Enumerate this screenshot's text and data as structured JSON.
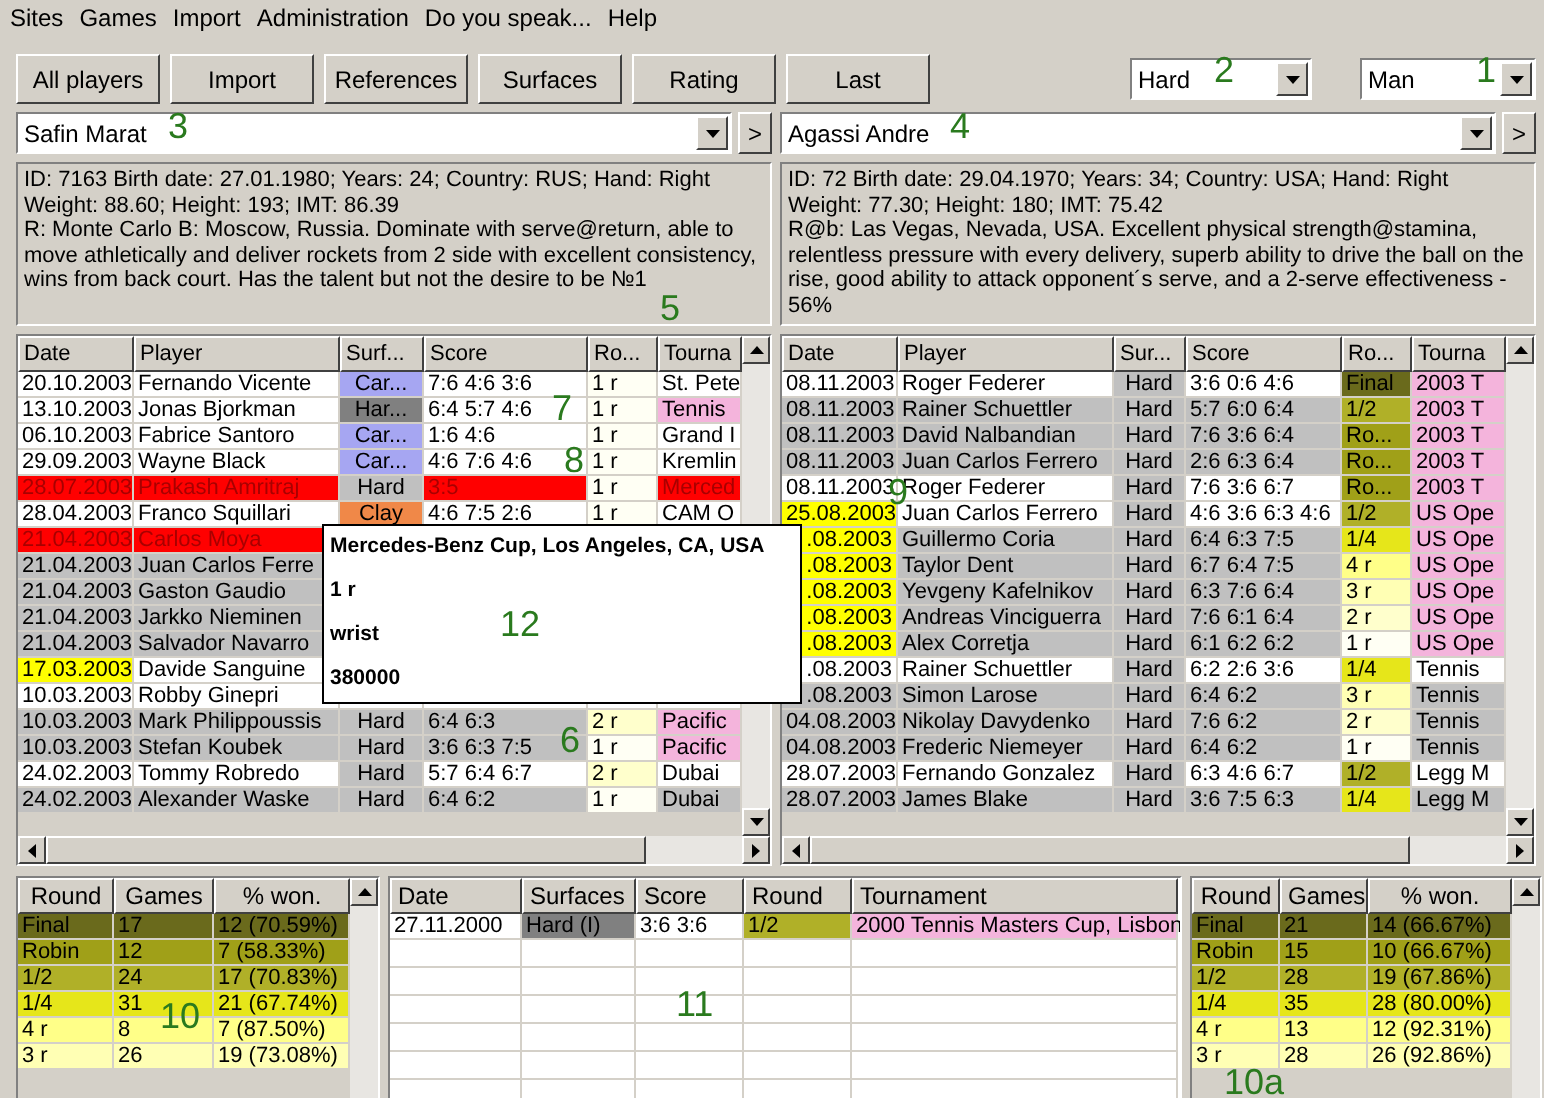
{
  "menu": [
    "Sites",
    "Games",
    "Import",
    "Administration",
    "Do you speak...",
    "Help"
  ],
  "toolbar": [
    "All players",
    "Import",
    "References",
    "Surfaces",
    "Rating",
    "Last"
  ],
  "surface_filter": {
    "value": "Hard"
  },
  "gender_filter": {
    "value": "Man"
  },
  "players": [
    {
      "name": "Safin Marat",
      "next_button": ">",
      "info": [
        "ID: 7163 Birth date: 27.01.1980; Years: 24; Country: RUS; Hand: Right",
        "Weight: 88.60; Height: 193; IMT: 86.39",
        "R: Monte Carlo B: Moscow, Russia. Dominate with serve@return, able to move athletically and deliver rockets from 2 side with excellent consistency, wins from back court. Has the talent but not the desire to be №1"
      ]
    },
    {
      "name": "Agassi Andre",
      "next_button": ">",
      "info": [
        "ID: 72 Birth date: 29.04.1970; Years: 34; Country: USA; Hand: Right",
        "Weight: 77.30; Height: 180; IMT: 75.42",
        "R@b: Las Vegas, Nevada, USA. Excellent physical strength@stamina, relentless pressure with every delivery, superb ability to drive the ball on the rise, good ability to attack opponent´s serve, and a 2-serve effectiveness - 56%"
      ]
    }
  ],
  "left_table": {
    "columns": [
      "Date",
      "Player",
      "Surf...",
      "Score",
      "Ro...",
      "Tourna"
    ],
    "rows": [
      {
        "date": "20.10.2003",
        "date_highlight": false,
        "player": "Fernando Vicente",
        "color": "#ffffff",
        "lost": false,
        "surface": {
          "text": "Car...",
          "color": "#a6a6f2"
        },
        "score": "7:6 4:6 3:6",
        "round": {
          "text": "1 r",
          "color": "#fffff4"
        },
        "tournament": {
          "text": "St. Pete"
        }
      },
      {
        "date": "13.10.2003",
        "date_highlight": false,
        "player": "Jonas Bjorkman",
        "color": "#ffffff",
        "lost": false,
        "surface": {
          "text": "Har...",
          "color": "#808080"
        },
        "score": "6:4 5:7 4:6",
        "round": {
          "text": "1 r",
          "color": "#fffff4"
        },
        "tournament": {
          "text": "Tennis",
          "color": "#f4b4dc"
        }
      },
      {
        "date": "06.10.2003",
        "date_highlight": false,
        "player": "Fabrice Santoro",
        "color": "#ffffff",
        "lost": false,
        "surface": {
          "text": "Car...",
          "color": "#a6a6f2"
        },
        "score": "1:6 4:6",
        "round": {
          "text": "1 r",
          "color": "#fffff4"
        },
        "tournament": {
          "text": "Grand I"
        }
      },
      {
        "date": "29.09.2003",
        "date_highlight": false,
        "player": "Wayne Black",
        "color": "#ffffff",
        "lost": false,
        "surface": {
          "text": "Car...",
          "color": "#a6a6f2"
        },
        "score": "4:6 7:6 4:6",
        "round": {
          "text": "1 r",
          "color": "#fffff4"
        },
        "tournament": {
          "text": "Kremlin"
        }
      },
      {
        "date": "28.07.2003",
        "date_highlight": false,
        "player": "Prakash Amritraj",
        "color": "#ff0000",
        "lost": true,
        "surface": {
          "text": "Hard",
          "color": "#c0c0c0"
        },
        "score": "3:5",
        "round": {
          "text": "1 r",
          "color": "#fffff4"
        },
        "tournament": {
          "text": "Merced"
        }
      },
      {
        "date": "28.04.2003",
        "date_highlight": false,
        "player": "Franco Squillari",
        "color": "#ffffff",
        "lost": false,
        "surface": {
          "text": "Clay",
          "color": "#f08848"
        },
        "score": "4:6 7:5 2:6",
        "round": {
          "text": "1 r",
          "color": "#fffff4"
        },
        "tournament": {
          "text": "CAM O"
        }
      },
      {
        "date": "21.04.2003",
        "date_highlight": false,
        "player": "Carlos Moya",
        "color": "#ff0000",
        "lost": true
      },
      {
        "date": "21.04.2003",
        "date_highlight": false,
        "player": "Juan Carlos Ferre",
        "color": "#c0c0c0",
        "lost": false
      },
      {
        "date": "21.04.2003",
        "date_highlight": false,
        "player": "Gaston Gaudio",
        "color": "#c0c0c0",
        "lost": false
      },
      {
        "date": "21.04.2003",
        "date_highlight": false,
        "player": "Jarkko Nieminen",
        "color": "#c0c0c0",
        "lost": false
      },
      {
        "date": "21.04.2003",
        "date_highlight": false,
        "player": "Salvador Navarro",
        "color": "#c0c0c0",
        "lost": false
      },
      {
        "date": "17.03.2003",
        "date_highlight": true,
        "player": "Davide Sanguine",
        "color": "#ffffff",
        "lost": false
      },
      {
        "date": "10.03.2003",
        "date_highlight": false,
        "player": "Robby Ginepri",
        "color": "#ffffff",
        "lost": false
      },
      {
        "date": "10.03.2003",
        "date_highlight": false,
        "player": "Mark Philippoussis",
        "color": "#c0c0c0",
        "lost": false,
        "surface": {
          "text": "Hard",
          "color": "#c0c0c0"
        },
        "score": "6:4 6:3",
        "round": {
          "text": "2 r",
          "color": "#ffffcc"
        },
        "tournament": {
          "text": "Pacific",
          "color": "#f4b4dc"
        }
      },
      {
        "date": "10.03.2003",
        "date_highlight": false,
        "player": "Stefan Koubek",
        "color": "#c0c0c0",
        "lost": false,
        "surface": {
          "text": "Hard",
          "color": "#c0c0c0"
        },
        "score": "3:6 6:3 7:5",
        "round": {
          "text": "1 r",
          "color": "#fffff4"
        },
        "tournament": {
          "text": "Pacific",
          "color": "#f4b4dc"
        }
      },
      {
        "date": "24.02.2003",
        "date_highlight": false,
        "player": "Tommy Robredo",
        "color": "#ffffff",
        "lost": false,
        "surface": {
          "text": "Hard",
          "color": "#c0c0c0"
        },
        "score": "5:7 6:4 6:7",
        "round": {
          "text": "2 r",
          "color": "#ffffcc"
        },
        "tournament": {
          "text": "Dubai"
        }
      },
      {
        "date": "24.02.2003",
        "date_highlight": false,
        "player": "Alexander Waske",
        "color": "#c0c0c0",
        "lost": false,
        "surface": {
          "text": "Hard",
          "color": "#c0c0c0"
        },
        "score": "6:4 6:2",
        "round": {
          "text": "1 r",
          "color": "#fffff4"
        },
        "tournament": {
          "text": "Dubai"
        }
      }
    ]
  },
  "right_table": {
    "columns": [
      "Date",
      "Player",
      "Sur...",
      "Score",
      "Ro...",
      "Tourna"
    ],
    "rows": [
      {
        "date": "08.11.2003",
        "date_highlight": false,
        "player": "Roger Federer",
        "color": "#ffffff",
        "lost": false,
        "surface": {
          "text": "Hard",
          "color": "#c0c0c0"
        },
        "score": "3:6 0:6 4:6",
        "round": {
          "text": "Final",
          "color": "#6a6a1c"
        },
        "tournament": {
          "text": "2003 T",
          "color": "#f4b4dc"
        }
      },
      {
        "date": "08.11.2003",
        "date_highlight": false,
        "player": "Rainer Schuettler",
        "color": "#c0c0c0",
        "lost": false,
        "surface": {
          "text": "Hard",
          "color": "#c0c0c0"
        },
        "score": "5:7 6:0 6:4",
        "round": {
          "text": "1/2",
          "color": "#b0b028"
        },
        "tournament": {
          "text": "2003 T",
          "color": "#f4b4dc"
        }
      },
      {
        "date": "08.11.2003",
        "date_highlight": false,
        "player": "David Nalbandian",
        "color": "#c0c0c0",
        "lost": false,
        "surface": {
          "text": "Hard",
          "color": "#c0c0c0"
        },
        "score": "7:6 3:6 6:4",
        "round": {
          "text": "Ro...",
          "color": "#a0a018"
        },
        "tournament": {
          "text": "2003 T",
          "color": "#f4b4dc"
        }
      },
      {
        "date": "08.11.2003",
        "date_highlight": false,
        "player": "Juan Carlos Ferrero",
        "color": "#c0c0c0",
        "lost": false,
        "surface": {
          "text": "Hard",
          "color": "#c0c0c0"
        },
        "score": "2:6 6:3 6:4",
        "round": {
          "text": "Ro...",
          "color": "#a0a018"
        },
        "tournament": {
          "text": "2003 T",
          "color": "#f4b4dc"
        }
      },
      {
        "date": "08.11.2003",
        "date_highlight": false,
        "player": "Roger Federer",
        "color": "#ffffff",
        "lost": false,
        "surface": {
          "text": "Hard",
          "color": "#c0c0c0"
        },
        "score": "7:6 3:6 6:7",
        "round": {
          "text": "Ro...",
          "color": "#a0a018"
        },
        "tournament": {
          "text": "2003 T",
          "color": "#f4b4dc"
        }
      },
      {
        "date": "25.08.2003",
        "date_highlight": true,
        "player": "Juan Carlos Ferrero",
        "color": "#ffffff",
        "lost": false,
        "surface": {
          "text": "Hard",
          "color": "#c0c0c0"
        },
        "score": "4:6 3:6 6:3 4:6",
        "round": {
          "text": "1/2",
          "color": "#b0b028"
        },
        "tournament": {
          "text": "US Ope",
          "color": "#f4b4dc"
        }
      },
      {
        "date": ".08.2003",
        "date_highlight": true,
        "player": "Guillermo Coria",
        "color": "#c0c0c0",
        "lost": false,
        "surface": {
          "text": "Hard",
          "color": "#c0c0c0"
        },
        "score": "6:4 6:3 7:5",
        "round": {
          "text": "1/4",
          "color": "#e6e61a"
        },
        "tournament": {
          "text": "US Ope",
          "color": "#f4b4dc"
        }
      },
      {
        "date": ".08.2003",
        "date_highlight": true,
        "player": "Taylor Dent",
        "color": "#c0c0c0",
        "lost": false,
        "surface": {
          "text": "Hard",
          "color": "#c0c0c0"
        },
        "score": "6:7 6:4 7:5",
        "round": {
          "text": "4 r",
          "color": "#ffff88"
        },
        "tournament": {
          "text": "US Ope",
          "color": "#f4b4dc"
        }
      },
      {
        "date": ".08.2003",
        "date_highlight": true,
        "player": "Yevgeny Kafelnikov",
        "color": "#c0c0c0",
        "lost": false,
        "surface": {
          "text": "Hard",
          "color": "#c0c0c0"
        },
        "score": "6:3 7:6 6:4",
        "round": {
          "text": "3 r",
          "color": "#ffffb4"
        },
        "tournament": {
          "text": "US Ope",
          "color": "#f4b4dc"
        }
      },
      {
        "date": ".08.2003",
        "date_highlight": true,
        "player": "Andreas Vinciguerra",
        "color": "#c0c0c0",
        "lost": false,
        "surface": {
          "text": "Hard",
          "color": "#c0c0c0"
        },
        "score": "7:6 6:1 6:4",
        "round": {
          "text": "2 r",
          "color": "#ffffcc"
        },
        "tournament": {
          "text": "US Ope",
          "color": "#f4b4dc"
        }
      },
      {
        "date": ".08.2003",
        "date_highlight": true,
        "player": "Alex Corretja",
        "color": "#c0c0c0",
        "lost": false,
        "surface": {
          "text": "Hard",
          "color": "#c0c0c0"
        },
        "score": "6:1 6:2 6:2",
        "round": {
          "text": "1 r",
          "color": "#fffff4"
        },
        "tournament": {
          "text": "US Ope",
          "color": "#f4b4dc"
        }
      },
      {
        "date": ".08.2003",
        "date_highlight": false,
        "player": "Rainer Schuettler",
        "color": "#ffffff",
        "lost": false,
        "surface": {
          "text": "Hard",
          "color": "#c0c0c0"
        },
        "score": "6:2 2:6 3:6",
        "round": {
          "text": "1/4",
          "color": "#e6e61a"
        },
        "tournament": {
          "text": "Tennis"
        }
      },
      {
        "date": ".08.2003",
        "date_highlight": false,
        "player": "Simon Larose",
        "color": "#c0c0c0",
        "lost": false,
        "surface": {
          "text": "Hard",
          "color": "#c0c0c0"
        },
        "score": "6:4 6:2",
        "round": {
          "text": "3 r",
          "color": "#ffffb4"
        },
        "tournament": {
          "text": "Tennis"
        }
      },
      {
        "date": "04.08.2003",
        "date_highlight": false,
        "player": "Nikolay Davydenko",
        "color": "#c0c0c0",
        "lost": false,
        "surface": {
          "text": "Hard",
          "color": "#c0c0c0"
        },
        "score": "7:6 6:2",
        "round": {
          "text": "2 r",
          "color": "#ffffcc"
        },
        "tournament": {
          "text": "Tennis"
        }
      },
      {
        "date": "04.08.2003",
        "date_highlight": false,
        "player": "Frederic Niemeyer",
        "color": "#c0c0c0",
        "lost": false,
        "surface": {
          "text": "Hard",
          "color": "#c0c0c0"
        },
        "score": "6:4 6:2",
        "round": {
          "text": "1 r",
          "color": "#fffff4"
        },
        "tournament": {
          "text": "Tennis"
        }
      },
      {
        "date": "28.07.2003",
        "date_highlight": false,
        "player": "Fernando Gonzalez",
        "color": "#ffffff",
        "lost": false,
        "surface": {
          "text": "Hard",
          "color": "#c0c0c0"
        },
        "score": "6:3 4:6 6:7",
        "round": {
          "text": "1/2",
          "color": "#b0b028"
        },
        "tournament": {
          "text": "Legg M"
        }
      },
      {
        "date": "28.07.2003",
        "date_highlight": false,
        "player": "James Blake",
        "color": "#c0c0c0",
        "lost": false,
        "surface": {
          "text": "Hard",
          "color": "#c0c0c0"
        },
        "score": "3:6 7:5 6:3",
        "round": {
          "text": "1/4",
          "color": "#e6e61a"
        },
        "tournament": {
          "text": "Legg M"
        }
      }
    ]
  },
  "tooltip": {
    "title": "Mercedes-Benz Cup, Los Angeles, CA, USA",
    "lines": [
      "1 r",
      "wrist",
      "380000"
    ]
  },
  "left_stats": {
    "columns": [
      "Round",
      "Games",
      "% won."
    ],
    "rows": [
      {
        "round": "Final",
        "games": "17",
        "won": "12 (70.59%)",
        "color": "#6a6a1c"
      },
      {
        "round": "Robin",
        "games": "12",
        "won": "7 (58.33%)",
        "color": "#a0a018"
      },
      {
        "round": "1/2",
        "games": "24",
        "won": "17 (70.83%)",
        "color": "#b0b028"
      },
      {
        "round": "1/4",
        "games": "31",
        "won": "21 (67.74%)",
        "color": "#e6e61a"
      },
      {
        "round": "4 r",
        "games": "8",
        "won": "7 (87.50%)",
        "color": "#ffff88"
      },
      {
        "round": "3 r",
        "games": "26",
        "won": "19 (73.08%)",
        "color": "#ffffb4"
      }
    ]
  },
  "head_to_head": {
    "columns": [
      "Date",
      "Surfaces",
      "Score",
      "Round",
      "Tournament"
    ],
    "rows": [
      {
        "date": "27.11.2000",
        "surface": {
          "text": "Hard (I)",
          "color": "#808080"
        },
        "score": "3:6 3:6",
        "round": {
          "text": "1/2",
          "color": "#b0b028"
        },
        "tournament": {
          "text": "2000 Tennis Masters Cup, Lisbon",
          "color": "#f4b4dc"
        }
      }
    ]
  },
  "right_stats": {
    "columns": [
      "Round",
      "Games",
      "% won."
    ],
    "rows": [
      {
        "round": "Final",
        "games": "21",
        "won": "14 (66.67%)",
        "color": "#6a6a1c"
      },
      {
        "round": "Robin",
        "games": "15",
        "won": "10 (66.67%)",
        "color": "#a0a018"
      },
      {
        "round": "1/2",
        "games": "28",
        "won": "19 (67.86%)",
        "color": "#b0b028"
      },
      {
        "round": "1/4",
        "games": "35",
        "won": "28 (80.00%)",
        "color": "#e6e61a"
      },
      {
        "round": "4 r",
        "games": "13",
        "won": "12 (92.31%)",
        "color": "#ffff88"
      },
      {
        "round": "3 r",
        "games": "28",
        "won": "26 (92.86%)",
        "color": "#ffffb4"
      }
    ]
  },
  "callouts": [
    {
      "text": "2"
    },
    {
      "text": "1"
    },
    {
      "text": "3"
    },
    {
      "text": "4"
    },
    {
      "text": "5"
    },
    {
      "text": "7"
    },
    {
      "text": "8"
    },
    {
      "text": "9"
    },
    {
      "text": "12"
    },
    {
      "text": "6"
    },
    {
      "text": "10"
    },
    {
      "text": "11"
    },
    {
      "text": "10a"
    }
  ]
}
